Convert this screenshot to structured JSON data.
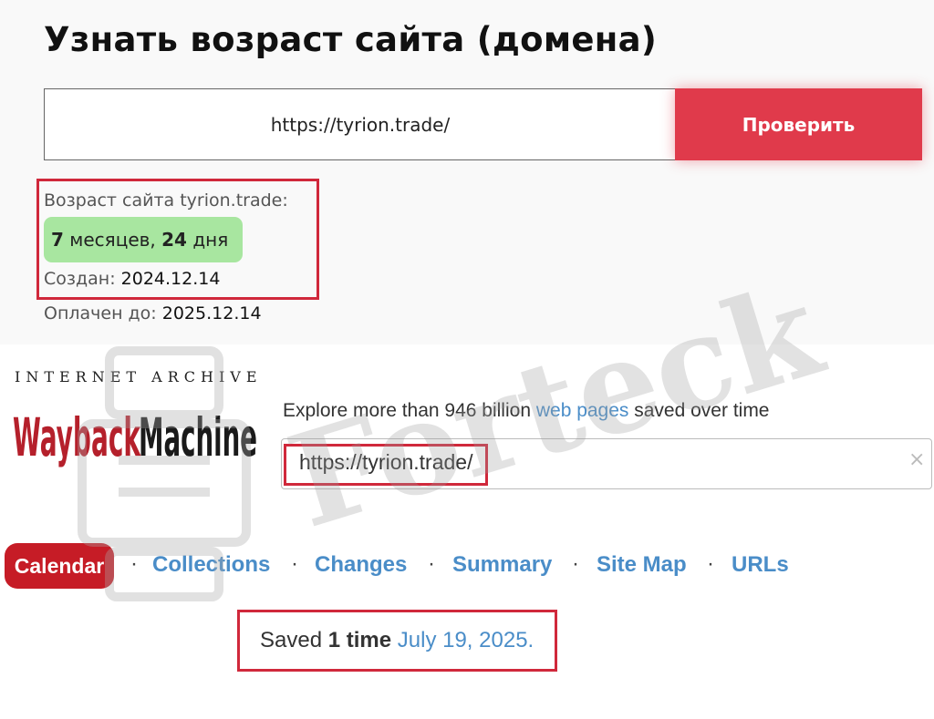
{
  "checker": {
    "title": "Узнать возраст сайта (домена)",
    "input_value": "https://tyrion.trade/",
    "button_label": "Проверить",
    "age_label": "Возраст сайта tyrion.trade:",
    "age_months": "7",
    "age_months_word": " месяцев, ",
    "age_days": "24",
    "age_days_word": " дня",
    "created_label": "Создан: ",
    "created_value": "2024.12.14",
    "paid_label": "Оплачен до: ",
    "paid_value": "2025.12.14"
  },
  "wayback": {
    "org_label": "INTERNET ARCHIVE",
    "logo_text": "WaybackMachine",
    "explore_prefix": "Explore more than 946 billion ",
    "explore_link": "web pages",
    "explore_suffix": " saved over time",
    "search_value": "https://tyrion.trade/",
    "clear_glyph": "×",
    "tabs": [
      {
        "label": "Calendar"
      },
      {
        "label": "Collections"
      },
      {
        "label": "Changes"
      },
      {
        "label": "Summary"
      },
      {
        "label": "Site Map"
      },
      {
        "label": "URLs"
      }
    ],
    "separator": "·",
    "saved_prefix": "Saved ",
    "saved_count": "1 time",
    "saved_date": "July 19, 2025."
  },
  "watermark": {
    "text": "Forteck"
  },
  "colors": {
    "button_red": "#e03a4b",
    "highlight_red": "#d0283b",
    "age_green": "#a8e6a0",
    "link_blue": "#4a8dc8",
    "calendar_red": "#c61c26"
  }
}
